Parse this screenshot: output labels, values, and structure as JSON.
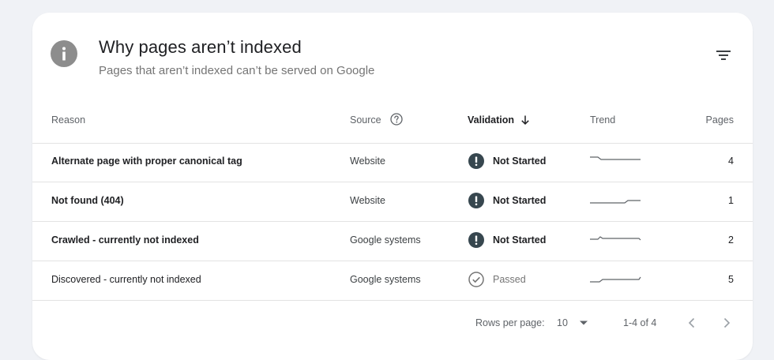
{
  "header": {
    "title": "Why pages aren’t indexed",
    "subtitle": "Pages that aren’t indexed can’t be served on Google",
    "info_icon": "info-icon",
    "filter_icon": "filter-icon"
  },
  "table": {
    "columns": {
      "reason": "Reason",
      "source": "Source",
      "validation": "Validation",
      "trend": "Trend",
      "pages": "Pages"
    },
    "rows": [
      {
        "reason": "Alternate page with proper canonical tag",
        "source": "Website",
        "validation": "Not Started",
        "pages": "4"
      },
      {
        "reason": "Not found (404)",
        "source": "Website",
        "validation": "Not Started",
        "pages": "1"
      },
      {
        "reason": "Crawled - currently not indexed",
        "source": "Google systems",
        "validation": "Not Started",
        "pages": "2"
      },
      {
        "reason": "Discovered - currently not indexed",
        "source": "Google systems",
        "validation": "Passed",
        "pages": "5"
      }
    ]
  },
  "pagination": {
    "rows_per_page_label": "Rows per page:",
    "rows_per_page_value": "10",
    "range": "1-4 of 4"
  },
  "colors": {
    "status_not_started": "#37474f",
    "status_passed": "#757575",
    "trend_line": "#5f6368"
  }
}
